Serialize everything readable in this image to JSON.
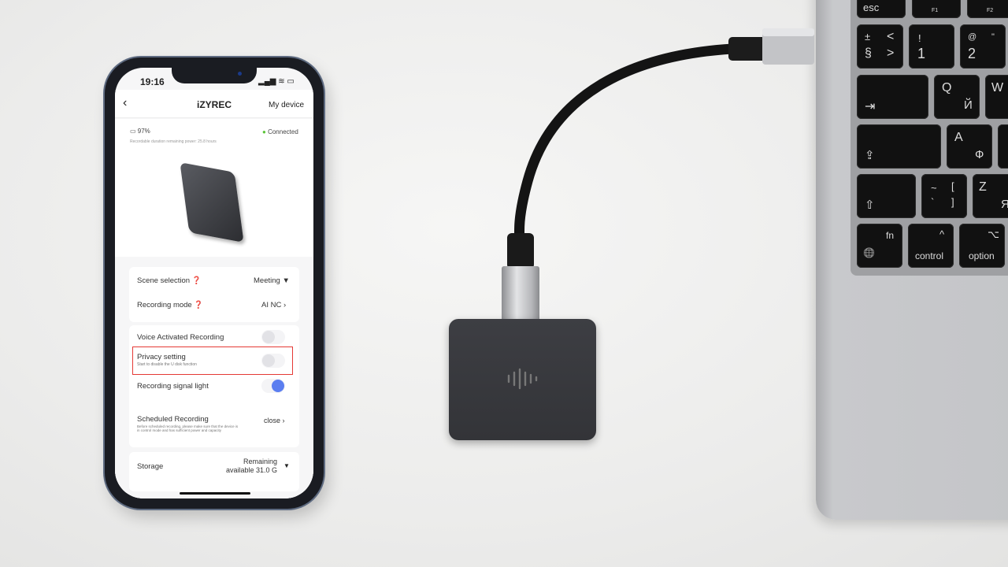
{
  "phone": {
    "status_time": "19:16",
    "header": {
      "title": "iZYREC",
      "right": "My device"
    },
    "device_info": {
      "battery": "97%",
      "status": "Connected",
      "status_color": "#5cc43a",
      "remaining": "Recordable duration remaining power: 25.8 hours"
    },
    "settings": {
      "scene_label": "Scene selection",
      "scene_value": "Meeting",
      "mode_label": "Recording mode",
      "mode_value": "AI NC",
      "voice_label": "Voice Activated Recording",
      "voice_on": false,
      "privacy_label": "Privacy setting",
      "privacy_sub": "Start to disable the U disk function",
      "privacy_on": false,
      "highlight_color": "#e53935",
      "light_label": "Recording signal light",
      "light_on": true,
      "toggle_color": "#5b7ef0",
      "scheduled_label": "Scheduled Recording",
      "scheduled_sub": "Before scheduled recording, please make sure that the device is in control mode and has sufficient power and capacity",
      "scheduled_value": "close",
      "storage_label": "Storage",
      "storage_value_1": "Remaining",
      "storage_value_2": "available 31.0 G"
    }
  },
  "keyboard": {
    "esc": "esc",
    "f1": "F1",
    "f2": "F2",
    "k_sect": [
      "±",
      "<",
      "§",
      ">"
    ],
    "k1": [
      "!",
      "1"
    ],
    "k2": [
      "@",
      "\"",
      "2"
    ],
    "tab": "⇥",
    "q": [
      "Q",
      "Й"
    ],
    "w": "W",
    "caps": "⇪",
    "a": [
      "A",
      "Ф"
    ],
    "shift": "⇧",
    "tilde": [
      "~",
      "[",
      "`",
      "]"
    ],
    "z": [
      "Z",
      "Я"
    ],
    "fn": "fn",
    "globe": "🌐",
    "control": [
      "^",
      "control"
    ],
    "option": [
      "⌥",
      "option"
    ]
  }
}
